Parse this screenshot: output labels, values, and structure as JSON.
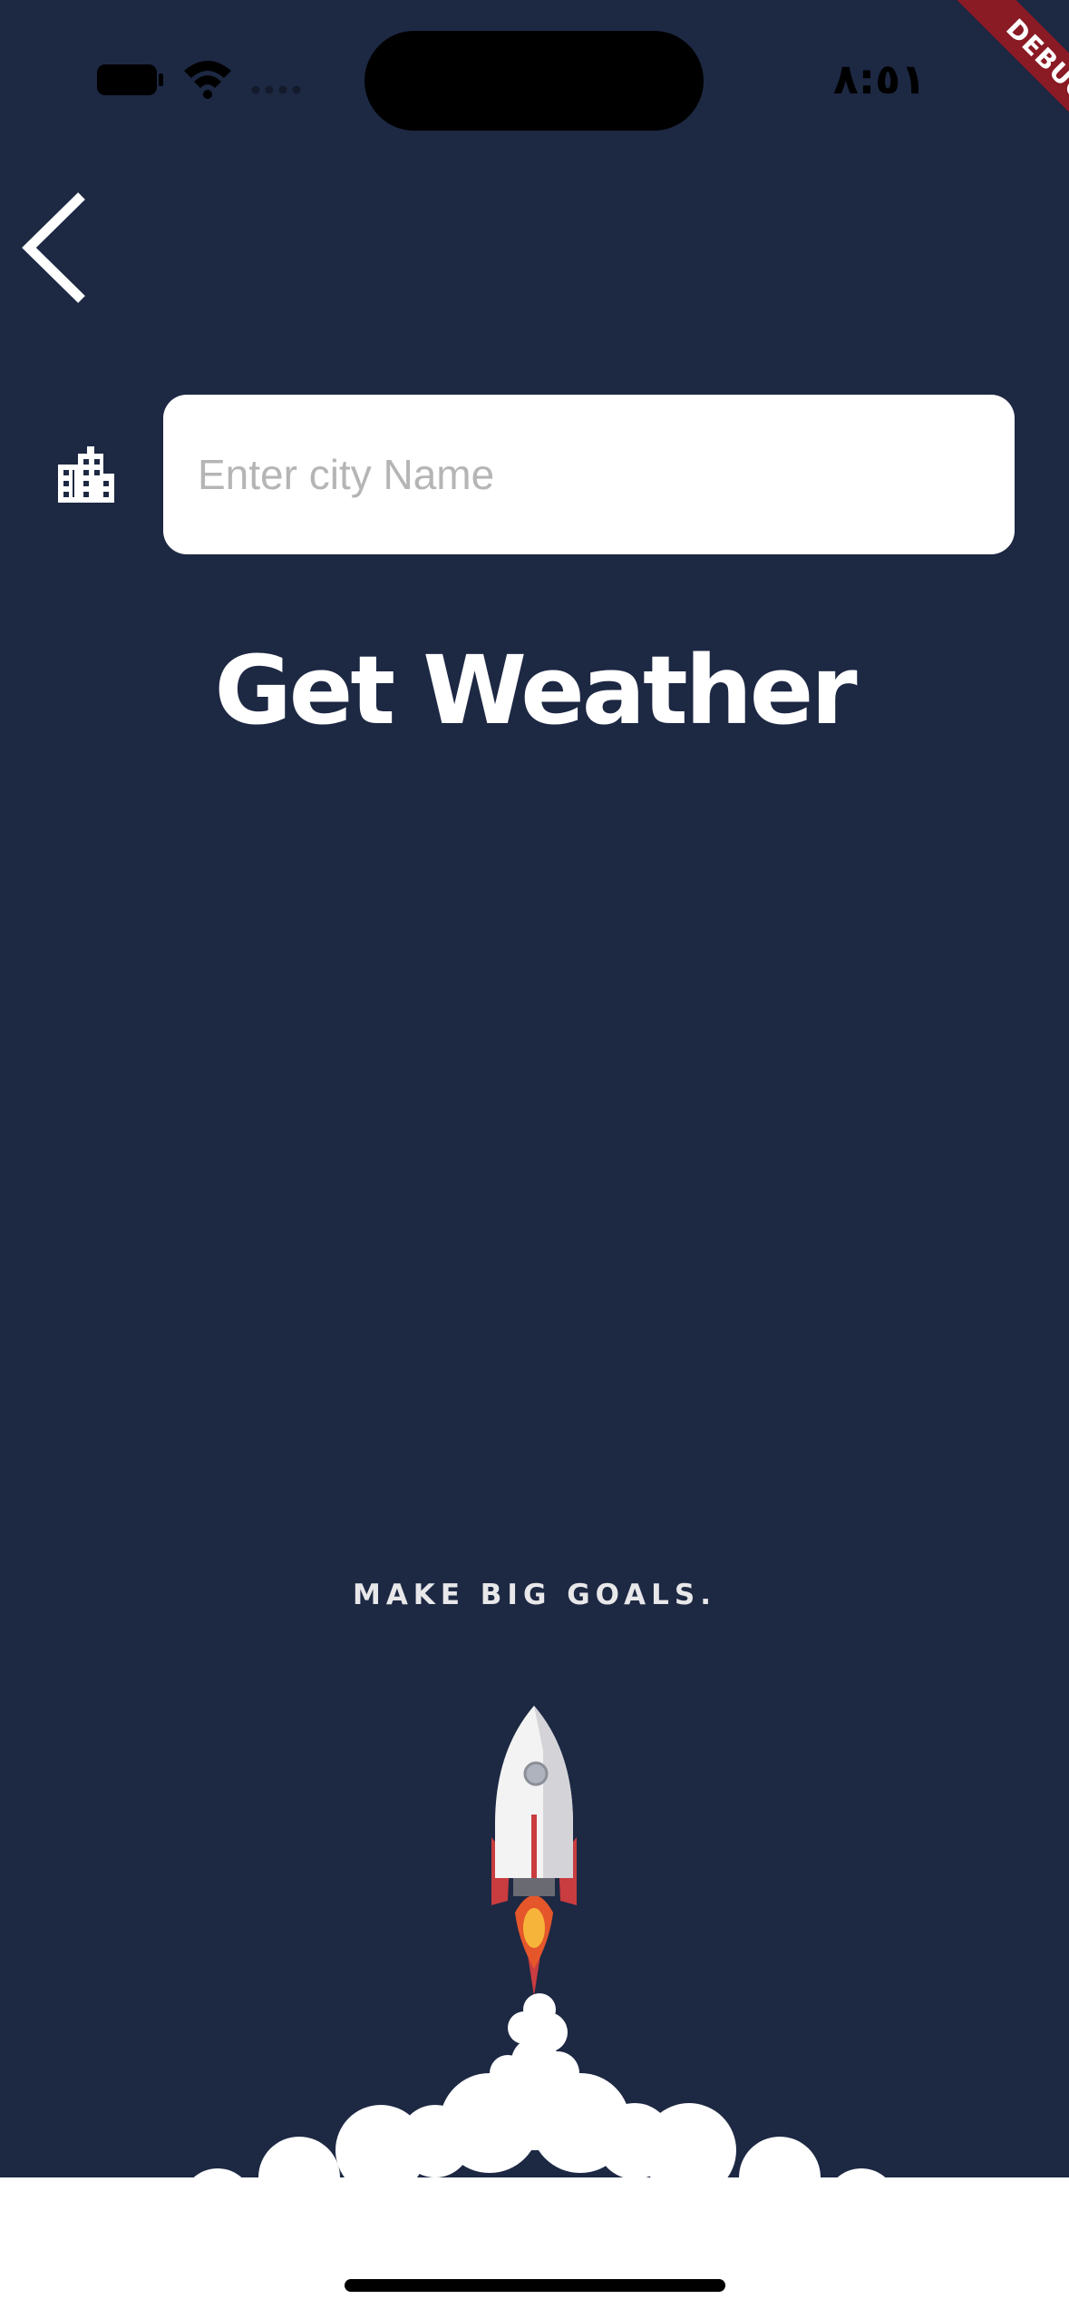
{
  "status_bar": {
    "time": "٨:٥١"
  },
  "debug_banner": {
    "label": "DEBUG"
  },
  "navigation": {
    "back_icon": "chevron-left-icon"
  },
  "search": {
    "icon": "city-buildings-icon",
    "placeholder": "Enter city Name",
    "value": ""
  },
  "action": {
    "label": "Get Weather"
  },
  "illustration": {
    "slogan": "MAKE BIG GOALS.",
    "subject": "rocket-launch-icon"
  },
  "colors": {
    "background": "#1d2843",
    "accent_red": "#c93c3f",
    "debug_banner": "#8a1a24",
    "input_background": "#ffffff"
  }
}
